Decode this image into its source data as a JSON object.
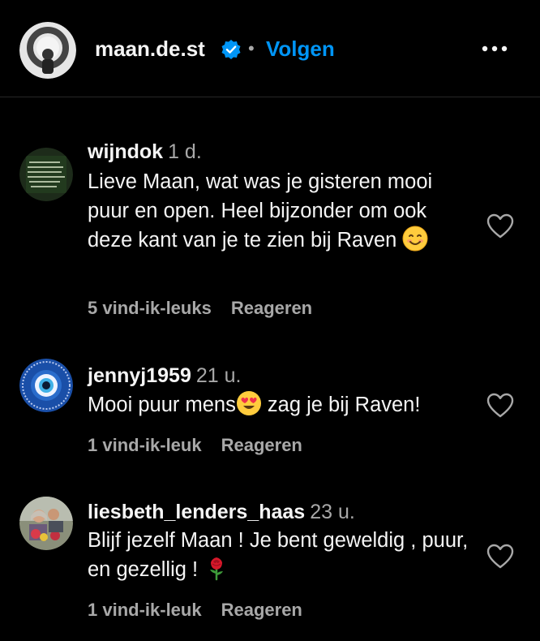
{
  "header": {
    "username": "maan.de.st",
    "separator": "•",
    "follow_label": "Volgen"
  },
  "comments": [
    {
      "username": "wijndok",
      "time": "1 d.",
      "text_before_emoji": "Lieve Maan, wat was je gisteren mooi puur en open. Heel bijzonder om ook deze kant van je te zien bij Raven ",
      "emoji": "smiling-face-icon",
      "text_after_emoji": "",
      "likes": "5 vind-ik-leuks",
      "reply_label": "Reageren"
    },
    {
      "username": "jennyj1959",
      "time": "21 u.",
      "text_before_emoji": "Mooi puur mens",
      "emoji": "heart-eyes-icon",
      "text_after_emoji": " zag je bij Raven!",
      "likes": "1 vind-ik-leuk",
      "reply_label": "Reageren"
    },
    {
      "username": "liesbeth_lenders_haas",
      "time": "23 u.",
      "text_before_emoji": "Blijf jezelf Maan ! Je bent geweldig , puur, en gezellig ! ",
      "emoji": "rose-icon",
      "text_after_emoji": "",
      "likes": "1 vind-ik-leuk",
      "reply_label": "Reageren"
    }
  ],
  "colors": {
    "background": "#000000",
    "primary_text": "#f5f5f5",
    "secondary_text": "#a8a8a8",
    "follow_blue": "#0095f6",
    "verified_blue": "#0095f6"
  }
}
